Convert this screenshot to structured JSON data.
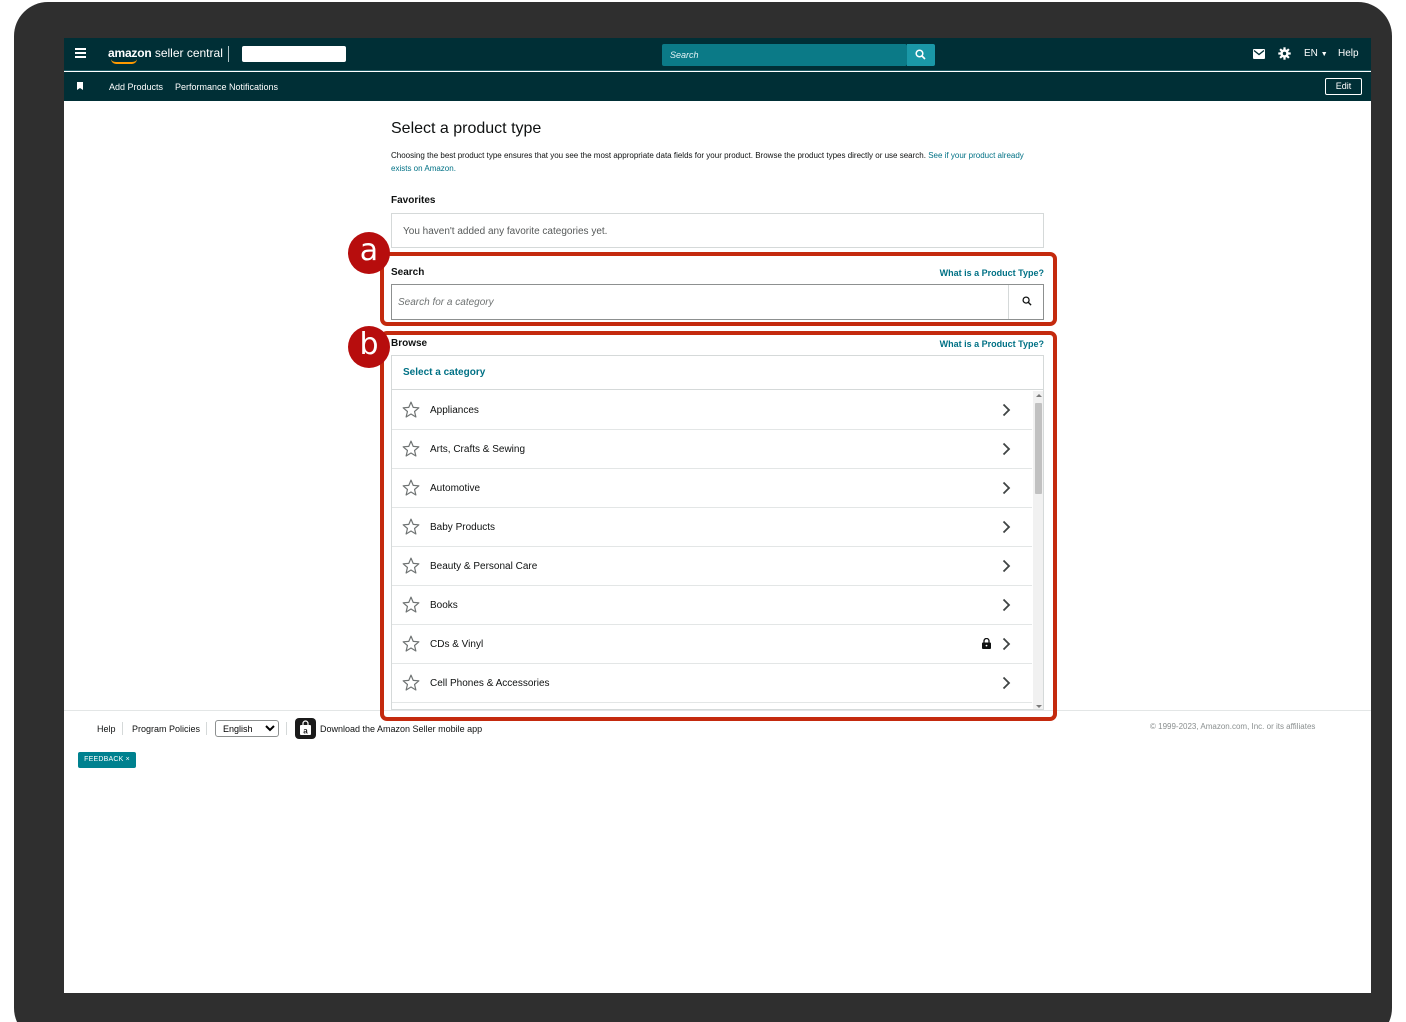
{
  "topbar": {
    "logo_brand": "amazon",
    "logo_product": "seller central",
    "search_placeholder": "Search",
    "language": "EN",
    "help": "Help",
    "icons": [
      "menu-icon",
      "search-icon",
      "mail-icon",
      "gear-icon"
    ]
  },
  "subbar": {
    "links": [
      "Add Products",
      "Performance Notifications"
    ],
    "edit_label": "Edit"
  },
  "main": {
    "title": "Select a product type",
    "description": "Choosing the best product type ensures that you see the most appropriate data fields for your product. Browse the product types directly or use search. ",
    "description_link": "See if your product already exists on Amazon.",
    "favorites": {
      "heading": "Favorites",
      "empty_text": "You haven't added any favorite categories yet."
    },
    "search": {
      "heading": "Search",
      "help_link": "What is a Product Type?",
      "placeholder": "Search for a category"
    },
    "browse": {
      "heading": "Browse",
      "help_link": "What is a Product Type?",
      "select_label": "Select a category",
      "categories": [
        {
          "label": "Appliances",
          "locked": false
        },
        {
          "label": "Arts, Crafts & Sewing",
          "locked": false
        },
        {
          "label": "Automotive",
          "locked": false
        },
        {
          "label": "Baby Products",
          "locked": false
        },
        {
          "label": "Beauty & Personal Care",
          "locked": false
        },
        {
          "label": "Books",
          "locked": false
        },
        {
          "label": "CDs & Vinyl",
          "locked": true
        },
        {
          "label": "Cell Phones & Accessories",
          "locked": false
        }
      ]
    }
  },
  "annotations": {
    "a": "a",
    "b": "b",
    "color": "#c42a0e"
  },
  "footer": {
    "help": "Help",
    "program_policies": "Program Policies",
    "language_selected": "English",
    "app_link": "Download the Amazon Seller mobile app",
    "copyright": "© 1999-2023, Amazon.com, Inc. or its affiliates",
    "feedback": "FEEDBACK ×"
  },
  "colors": {
    "nav_bg": "#002f36",
    "accent": "#007185",
    "search_bg": "#0b7a87"
  }
}
